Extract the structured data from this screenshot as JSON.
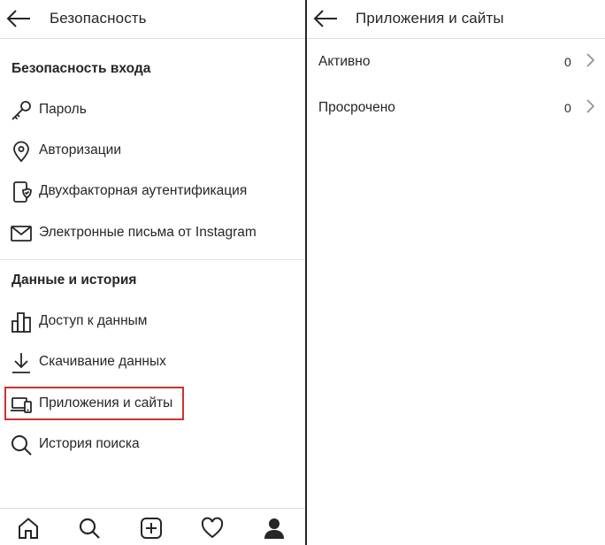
{
  "left_panel": {
    "header": {
      "title": "Безопасность",
      "back_icon": "arrow-left-icon"
    },
    "sections": [
      {
        "title": "Безопасность входа",
        "items": [
          {
            "label": "Пароль",
            "icon": "key-icon"
          },
          {
            "label": "Авторизации",
            "icon": "location-pin-icon"
          },
          {
            "label": "Двухфакторная аутентификация",
            "icon": "phone-shield-icon"
          },
          {
            "label": "Электронные письма от Instagram",
            "icon": "envelope-icon"
          }
        ]
      },
      {
        "title": "Данные и история",
        "items": [
          {
            "label": "Доступ к данным",
            "icon": "bar-chart-icon"
          },
          {
            "label": "Скачивание данных",
            "icon": "download-icon"
          },
          {
            "label": "Приложения и сайты",
            "icon": "devices-icon",
            "highlighted": true
          },
          {
            "label": "История поиска",
            "icon": "search-icon"
          }
        ]
      }
    ],
    "bottom_nav": [
      {
        "name": "home",
        "icon": "home-icon"
      },
      {
        "name": "search",
        "icon": "search-icon"
      },
      {
        "name": "new-post",
        "icon": "plus-square-icon"
      },
      {
        "name": "activity",
        "icon": "heart-icon"
      },
      {
        "name": "profile",
        "icon": "profile-icon",
        "active": true
      }
    ]
  },
  "right_panel": {
    "header": {
      "title": "Приложения и сайты",
      "back_icon": "arrow-left-icon"
    },
    "rows": [
      {
        "label": "Активно",
        "count": "0",
        "icon": "chevron-right-icon"
      },
      {
        "label": "Просрочено",
        "count": "0",
        "icon": "chevron-right-icon"
      }
    ]
  },
  "colors": {
    "text": "#262626",
    "divider": "#dbdbdb",
    "highlight_border": "#d0312d",
    "chevron": "#8e8e8e"
  }
}
